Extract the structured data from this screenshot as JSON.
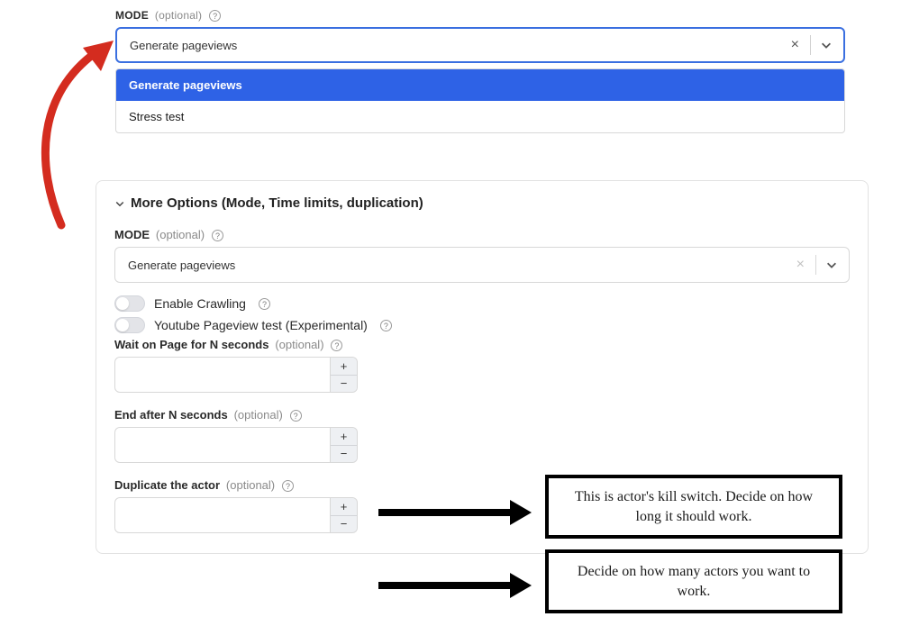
{
  "top": {
    "label": "MODE",
    "optional_tag": "(optional)",
    "value": "Generate pageviews",
    "options": [
      "Generate pageviews",
      "Stress test"
    ]
  },
  "more_options": {
    "title": "More Options (Mode, Time limits, duplication)",
    "mode": {
      "label": "MODE",
      "optional_tag": "(optional)",
      "value": "Generate pageviews"
    },
    "toggles": {
      "crawl_label": "Enable Crawling",
      "youtube_label": "Youtube Pageview test (Experimental)"
    },
    "wait": {
      "label": "Wait on Page for N seconds",
      "optional_tag": "(optional)",
      "value": ""
    },
    "end": {
      "label": "End after N seconds",
      "optional_tag": "(optional)",
      "value": ""
    },
    "dup": {
      "label": "Duplicate the actor",
      "optional_tag": "(optional)",
      "value": ""
    }
  },
  "callouts": {
    "kill_switch": "This is actor's kill switch. Decide on how long it should work.",
    "duplicate": "Decide on how many actors you want to work."
  }
}
